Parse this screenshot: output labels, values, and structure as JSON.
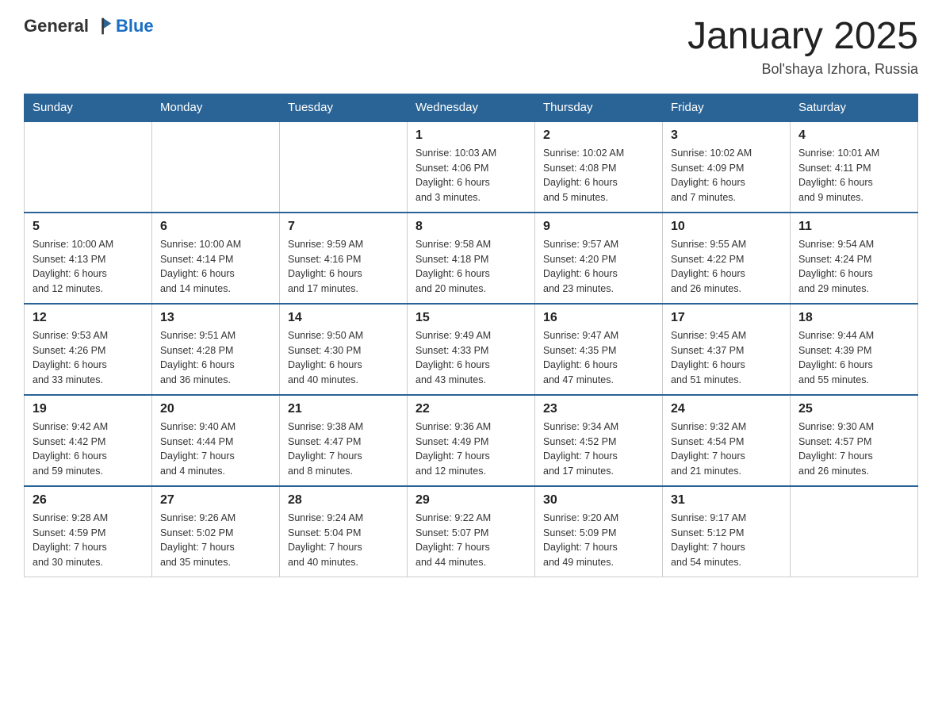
{
  "header": {
    "logo_general": "General",
    "logo_blue": "Blue",
    "title": "January 2025",
    "location": "Bol'shaya Izhora, Russia"
  },
  "days_of_week": [
    "Sunday",
    "Monday",
    "Tuesday",
    "Wednesday",
    "Thursday",
    "Friday",
    "Saturday"
  ],
  "weeks": [
    [
      {
        "day": "",
        "info": ""
      },
      {
        "day": "",
        "info": ""
      },
      {
        "day": "",
        "info": ""
      },
      {
        "day": "1",
        "info": "Sunrise: 10:03 AM\nSunset: 4:06 PM\nDaylight: 6 hours\nand 3 minutes."
      },
      {
        "day": "2",
        "info": "Sunrise: 10:02 AM\nSunset: 4:08 PM\nDaylight: 6 hours\nand 5 minutes."
      },
      {
        "day": "3",
        "info": "Sunrise: 10:02 AM\nSunset: 4:09 PM\nDaylight: 6 hours\nand 7 minutes."
      },
      {
        "day": "4",
        "info": "Sunrise: 10:01 AM\nSunset: 4:11 PM\nDaylight: 6 hours\nand 9 minutes."
      }
    ],
    [
      {
        "day": "5",
        "info": "Sunrise: 10:00 AM\nSunset: 4:13 PM\nDaylight: 6 hours\nand 12 minutes."
      },
      {
        "day": "6",
        "info": "Sunrise: 10:00 AM\nSunset: 4:14 PM\nDaylight: 6 hours\nand 14 minutes."
      },
      {
        "day": "7",
        "info": "Sunrise: 9:59 AM\nSunset: 4:16 PM\nDaylight: 6 hours\nand 17 minutes."
      },
      {
        "day": "8",
        "info": "Sunrise: 9:58 AM\nSunset: 4:18 PM\nDaylight: 6 hours\nand 20 minutes."
      },
      {
        "day": "9",
        "info": "Sunrise: 9:57 AM\nSunset: 4:20 PM\nDaylight: 6 hours\nand 23 minutes."
      },
      {
        "day": "10",
        "info": "Sunrise: 9:55 AM\nSunset: 4:22 PM\nDaylight: 6 hours\nand 26 minutes."
      },
      {
        "day": "11",
        "info": "Sunrise: 9:54 AM\nSunset: 4:24 PM\nDaylight: 6 hours\nand 29 minutes."
      }
    ],
    [
      {
        "day": "12",
        "info": "Sunrise: 9:53 AM\nSunset: 4:26 PM\nDaylight: 6 hours\nand 33 minutes."
      },
      {
        "day": "13",
        "info": "Sunrise: 9:51 AM\nSunset: 4:28 PM\nDaylight: 6 hours\nand 36 minutes."
      },
      {
        "day": "14",
        "info": "Sunrise: 9:50 AM\nSunset: 4:30 PM\nDaylight: 6 hours\nand 40 minutes."
      },
      {
        "day": "15",
        "info": "Sunrise: 9:49 AM\nSunset: 4:33 PM\nDaylight: 6 hours\nand 43 minutes."
      },
      {
        "day": "16",
        "info": "Sunrise: 9:47 AM\nSunset: 4:35 PM\nDaylight: 6 hours\nand 47 minutes."
      },
      {
        "day": "17",
        "info": "Sunrise: 9:45 AM\nSunset: 4:37 PM\nDaylight: 6 hours\nand 51 minutes."
      },
      {
        "day": "18",
        "info": "Sunrise: 9:44 AM\nSunset: 4:39 PM\nDaylight: 6 hours\nand 55 minutes."
      }
    ],
    [
      {
        "day": "19",
        "info": "Sunrise: 9:42 AM\nSunset: 4:42 PM\nDaylight: 6 hours\nand 59 minutes."
      },
      {
        "day": "20",
        "info": "Sunrise: 9:40 AM\nSunset: 4:44 PM\nDaylight: 7 hours\nand 4 minutes."
      },
      {
        "day": "21",
        "info": "Sunrise: 9:38 AM\nSunset: 4:47 PM\nDaylight: 7 hours\nand 8 minutes."
      },
      {
        "day": "22",
        "info": "Sunrise: 9:36 AM\nSunset: 4:49 PM\nDaylight: 7 hours\nand 12 minutes."
      },
      {
        "day": "23",
        "info": "Sunrise: 9:34 AM\nSunset: 4:52 PM\nDaylight: 7 hours\nand 17 minutes."
      },
      {
        "day": "24",
        "info": "Sunrise: 9:32 AM\nSunset: 4:54 PM\nDaylight: 7 hours\nand 21 minutes."
      },
      {
        "day": "25",
        "info": "Sunrise: 9:30 AM\nSunset: 4:57 PM\nDaylight: 7 hours\nand 26 minutes."
      }
    ],
    [
      {
        "day": "26",
        "info": "Sunrise: 9:28 AM\nSunset: 4:59 PM\nDaylight: 7 hours\nand 30 minutes."
      },
      {
        "day": "27",
        "info": "Sunrise: 9:26 AM\nSunset: 5:02 PM\nDaylight: 7 hours\nand 35 minutes."
      },
      {
        "day": "28",
        "info": "Sunrise: 9:24 AM\nSunset: 5:04 PM\nDaylight: 7 hours\nand 40 minutes."
      },
      {
        "day": "29",
        "info": "Sunrise: 9:22 AM\nSunset: 5:07 PM\nDaylight: 7 hours\nand 44 minutes."
      },
      {
        "day": "30",
        "info": "Sunrise: 9:20 AM\nSunset: 5:09 PM\nDaylight: 7 hours\nand 49 minutes."
      },
      {
        "day": "31",
        "info": "Sunrise: 9:17 AM\nSunset: 5:12 PM\nDaylight: 7 hours\nand 54 minutes."
      },
      {
        "day": "",
        "info": ""
      }
    ]
  ]
}
